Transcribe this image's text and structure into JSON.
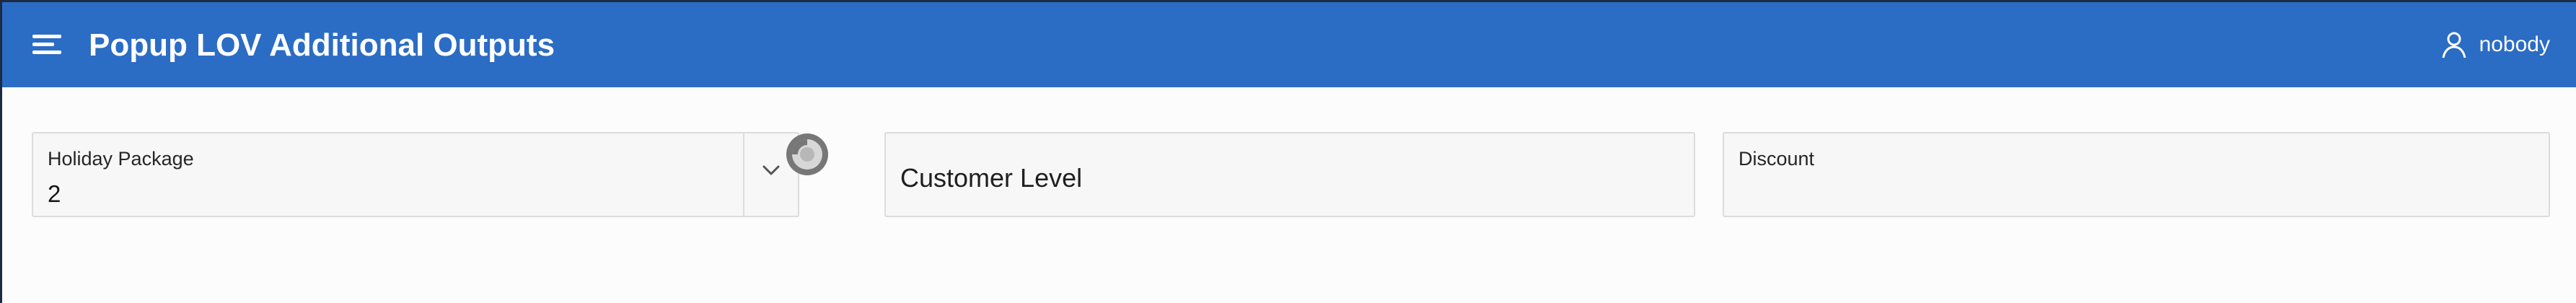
{
  "header": {
    "title": "Popup LOV Additional Outputs",
    "menu_icon": "hamburger-menu-icon",
    "user_icon": "user-icon",
    "username": "nobody",
    "background_color": "#2b6cc4"
  },
  "form": {
    "holiday_package": {
      "label": "Holiday Package",
      "value": "2",
      "button_icon": "chevron-down-icon"
    },
    "customer_level": {
      "label": "Customer Level",
      "value": ""
    },
    "discount": {
      "label": "Discount",
      "value": ""
    }
  },
  "status": {
    "loading_indicator_icon": "spinner-icon"
  }
}
